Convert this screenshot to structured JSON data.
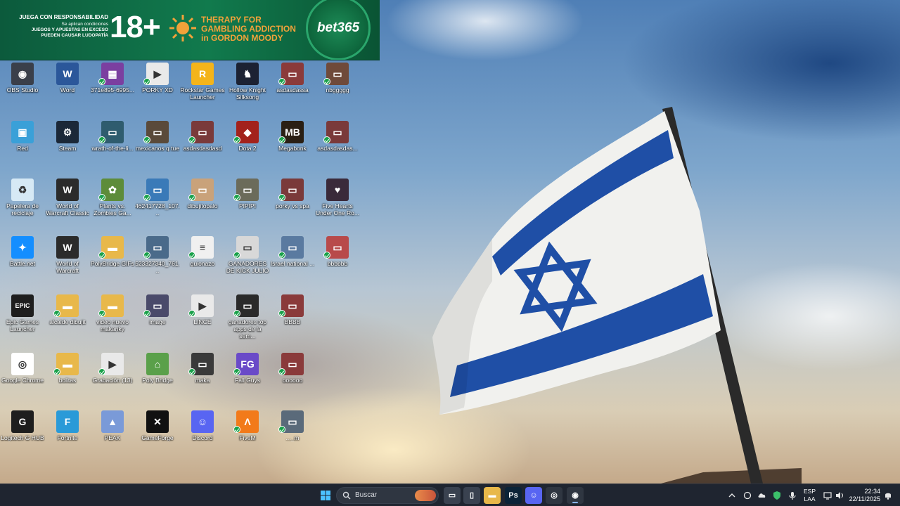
{
  "banner": {
    "line1": "JUEGA CON RESPONSABILIDAD",
    "line2": "Se aplican condiciones",
    "line3": "JUEGOS Y APUESTAS EN EXCESO",
    "line4": "PUEDEN CAUSAR LUDOPATÍA",
    "age": "18+",
    "therapy1": "THERAPY FOR",
    "therapy2": "GAMBLING ADDICTION",
    "therapy3": "in GORDON MOODY",
    "brand": "bet365",
    "sun_icon": "sun-logo-icon"
  },
  "desktop": {
    "icons": [
      {
        "name": "obs-studio",
        "label": "OBS Studio",
        "icon": "obs-icon",
        "color": "#3a3f4a",
        "glyph": "◉",
        "sync": false
      },
      {
        "name": "word",
        "label": "Word",
        "icon": "word-icon",
        "color": "#2b579a",
        "glyph": "W",
        "sync": false
      },
      {
        "name": "file-371e",
        "label": "371e895-6995...",
        "icon": "document-icon",
        "color": "#7b3fa0",
        "glyph": "▦",
        "sync": true
      },
      {
        "name": "porky-xd",
        "label": "PORKY XD",
        "icon": "video-file-icon",
        "color": "#e9e9e9",
        "glyph": "▶",
        "sync": true
      },
      {
        "name": "rockstar-games-launcher",
        "label": "Rockstar Games Launcher",
        "icon": "rockstar-icon",
        "color": "#f4b41a",
        "glyph": "R",
        "sync": false
      },
      {
        "name": "hollow-knight-silksong",
        "label": "Hollow Knight Silksong",
        "icon": "hollow-knight-icon",
        "color": "#1c2233",
        "glyph": "♞",
        "sync": false
      },
      {
        "name": "asdasdassa",
        "label": "asdasdassa",
        "icon": "image-file-icon",
        "color": "#8b3a3a",
        "glyph": "▭",
        "sync": true
      },
      {
        "name": "nbggggg",
        "label": "nbggggg",
        "icon": "image-file-icon",
        "color": "#6f4a3a",
        "glyph": "▭",
        "sync": true
      },
      {
        "name": "red",
        "label": "Red",
        "icon": "network-icon",
        "color": "#3aa0d8",
        "glyph": "▣",
        "sync": false
      },
      {
        "name": "steam",
        "label": "Steam",
        "icon": "steam-icon",
        "color": "#1b2838",
        "glyph": "⚙",
        "sync": false
      },
      {
        "name": "wrath-of-the-lich",
        "label": "wrath-of-the-li...",
        "icon": "image-file-icon",
        "color": "#2f5c6e",
        "glyph": "▭",
        "sync": true
      },
      {
        "name": "mexicanos-q-tue",
        "label": "mexicanos q tue",
        "icon": "image-file-icon",
        "color": "#5a4a3a",
        "glyph": "▭",
        "sync": true
      },
      {
        "name": "asdasdasdasd",
        "label": "asdasdasdasd",
        "icon": "image-file-icon",
        "color": "#7a3a3a",
        "glyph": "▭",
        "sync": true
      },
      {
        "name": "dota-2",
        "label": "Dota 2",
        "icon": "dota-icon",
        "color": "#a3221c",
        "glyph": "◆",
        "sync": true
      },
      {
        "name": "megabonk",
        "label": "Megabonk",
        "icon": "megabonk-icon",
        "color": "#2a1f14",
        "glyph": "MB",
        "sync": true
      },
      {
        "name": "asdasdasdas",
        "label": "asdasdasdas...",
        "icon": "image-file-icon",
        "color": "#7a3a3a",
        "glyph": "▭",
        "sync": true
      },
      {
        "name": "papelera",
        "label": "Papelera de reciclaje",
        "icon": "recycle-bin-icon",
        "color": "#d6e9f5",
        "glyph": "♻",
        "sync": false
      },
      {
        "name": "wow-classic",
        "label": "World of Warcraft Classic",
        "icon": "wow-icon",
        "color": "#2b2b2b",
        "glyph": "W",
        "sync": false
      },
      {
        "name": "plants-vs-zombies",
        "label": "Plants vs. Zombies Ga...",
        "icon": "pvz-icon",
        "color": "#5d8c3a",
        "glyph": "✿",
        "sync": true
      },
      {
        "name": "file-462417",
        "label": "462417728_107...",
        "icon": "image-file-icon",
        "color": "#3a7ab8",
        "glyph": "▭",
        "sync": true
      },
      {
        "name": "dibujitopalo",
        "label": "dibujitopalo",
        "icon": "image-file-icon",
        "color": "#c9a27a",
        "glyph": "▭",
        "sync": true
      },
      {
        "name": "pipipi",
        "label": "PIPIPI",
        "icon": "image-file-icon",
        "color": "#6b6b5a",
        "glyph": "▭",
        "sync": true
      },
      {
        "name": "porky-vs-spa",
        "label": "porky vs spa",
        "icon": "image-file-icon",
        "color": "#7a3a3a",
        "glyph": "▭",
        "sync": true
      },
      {
        "name": "five-hearts",
        "label": "Five Hearts Under One Ro...",
        "icon": "game-cover-icon",
        "color": "#3a2a3a",
        "glyph": "♥",
        "sync": false
      },
      {
        "name": "battle-net",
        "label": "Battle.net",
        "icon": "battlenet-icon",
        "color": "#148eff",
        "glyph": "✦",
        "sync": false
      },
      {
        "name": "wow",
        "label": "World of Warcraft",
        "icon": "wow-icon",
        "color": "#2b2b2b",
        "glyph": "W",
        "sync": false
      },
      {
        "name": "polybridge-gifs",
        "label": "PolyBridge GIFs",
        "icon": "folder-icon",
        "color": "#e8b84a",
        "glyph": "▬",
        "sync": true
      },
      {
        "name": "file-523327",
        "label": "523327340_761...",
        "icon": "image-file-icon",
        "color": "#4a6a8a",
        "glyph": "▭",
        "sync": true
      },
      {
        "name": "guionazo",
        "label": "guionazo",
        "icon": "word-doc-icon",
        "color": "#f0f0f0",
        "glyph": "≡",
        "sync": true
      },
      {
        "name": "ganadores-kick",
        "label": "GANADORES DE KICK JULIO",
        "icon": "image-file-icon",
        "color": "#d8d8d8",
        "glyph": "▭",
        "sync": true
      },
      {
        "name": "israel-national",
        "label": "Israel national ...",
        "icon": "image-file-icon",
        "color": "#5a7aa0",
        "glyph": "▭",
        "sync": true
      },
      {
        "name": "bbbbbb",
        "label": "bbbbbb",
        "icon": "image-file-icon",
        "color": "#b84a4a",
        "glyph": "▭",
        "sync": true
      },
      {
        "name": "epic-games",
        "label": "Epic Games Launcher",
        "icon": "epic-icon",
        "color": "#1e1e1e",
        "glyph": "EPIC",
        "sync": false
      },
      {
        "name": "alcalde-dibujit",
        "label": "alcalde dibujit",
        "icon": "folder-icon",
        "color": "#e8b84a",
        "glyph": "▬",
        "sync": true
      },
      {
        "name": "video-nuevo",
        "label": "video nuevo makanky",
        "icon": "folder-icon",
        "color": "#e8b84a",
        "glyph": "▬",
        "sync": true
      },
      {
        "name": "image",
        "label": "image",
        "icon": "image-file-icon",
        "color": "#4a4a6a",
        "glyph": "▭",
        "sync": true
      },
      {
        "name": "lince",
        "label": "LINCE",
        "icon": "video-file-icon",
        "color": "#e9e9e9",
        "glyph": "▶",
        "sync": true
      },
      {
        "name": "ganadores-top",
        "label": "ganadores top apps de la sem...",
        "icon": "image-file-icon",
        "color": "#2a2a2a",
        "glyph": "▭",
        "sync": true
      },
      {
        "name": "bbbb",
        "label": "BBBB",
        "icon": "image-file-icon",
        "color": "#8a3a3a",
        "glyph": "▭",
        "sync": true
      },
      {
        "name": "google-chrome",
        "label": "Google Chrome",
        "icon": "chrome-icon",
        "color": "#ffffff",
        "glyph": "◎",
        "sync": false
      },
      {
        "name": "bolitas",
        "label": "bolitas",
        "icon": "folder-icon",
        "color": "#e8b84a",
        "glyph": "▬",
        "sync": true
      },
      {
        "name": "grabacion",
        "label": "Grabación (13)",
        "icon": "video-file-icon",
        "color": "#e9e9e9",
        "glyph": "▶",
        "sync": true
      },
      {
        "name": "poly-bridge",
        "label": "Poly Bridge",
        "icon": "polybridge-icon",
        "color": "#5aa04a",
        "glyph": "⌂",
        "sync": false
      },
      {
        "name": "maka",
        "label": "maka",
        "icon": "image-file-icon",
        "color": "#3a3a3a",
        "glyph": "▭",
        "sync": true
      },
      {
        "name": "fall-guys",
        "label": "Fall Guys",
        "icon": "fallguys-icon",
        "color": "#6a4ac8",
        "glyph": "FG",
        "sync": true
      },
      {
        "name": "oooooo",
        "label": "oooooo",
        "icon": "image-file-icon",
        "color": "#8a3a3a",
        "glyph": "▭",
        "sync": true
      },
      {
        "name": "logitech-g-hub",
        "label": "Logitech G HUB",
        "icon": "logitech-icon",
        "color": "#1e1e1e",
        "glyph": "G",
        "sync": false
      },
      {
        "name": "fortnite",
        "label": "Fortnite",
        "icon": "fortnite-icon",
        "color": "#2a9ad8",
        "glyph": "F",
        "sync": false
      },
      {
        "name": "peak",
        "label": "PEAK",
        "icon": "peak-icon",
        "color": "#7a9ad8",
        "glyph": "▲",
        "sync": false
      },
      {
        "name": "gameforge",
        "label": "GameForge",
        "icon": "gameforge-icon",
        "color": "#111111",
        "glyph": "✕",
        "sync": false
      },
      {
        "name": "discord",
        "label": "Discord",
        "icon": "discord-icon",
        "color": "#5865f2",
        "glyph": "☺",
        "sync": false
      },
      {
        "name": "fiveml",
        "label": "FiveM",
        "icon": "fivem-icon",
        "color": "#f27a1a",
        "glyph": "Λ",
        "sync": true
      },
      {
        "name": "file-m",
        "label": "..._m",
        "icon": "image-file-icon",
        "color": "#5a6a7a",
        "glyph": "▭",
        "sync": true
      }
    ]
  },
  "taskbar": {
    "search_placeholder": "Buscar",
    "start_icon": "windows-start-icon",
    "apps": [
      {
        "name": "task-view-icon",
        "glyph": "▭",
        "color": "#3a4250"
      },
      {
        "name": "file-icon",
        "glyph": "▯",
        "color": "#3a4250"
      },
      {
        "name": "file-explorer-icon",
        "glyph": "▬",
        "color": "#e8b84a"
      },
      {
        "name": "photoshop-icon",
        "glyph": "Ps",
        "color": "#0b2338"
      },
      {
        "name": "discord-taskbar-icon",
        "glyph": "☺",
        "color": "#5865f2"
      },
      {
        "name": "chrome-taskbar-icon",
        "glyph": "◎",
        "color": "#2f3641"
      },
      {
        "name": "obs-taskbar-icon",
        "glyph": "◉",
        "color": "#2f3641"
      }
    ],
    "language_line1": "ESP",
    "language_line2": "LAA",
    "time": "22:34",
    "date": "22/11/2025"
  }
}
